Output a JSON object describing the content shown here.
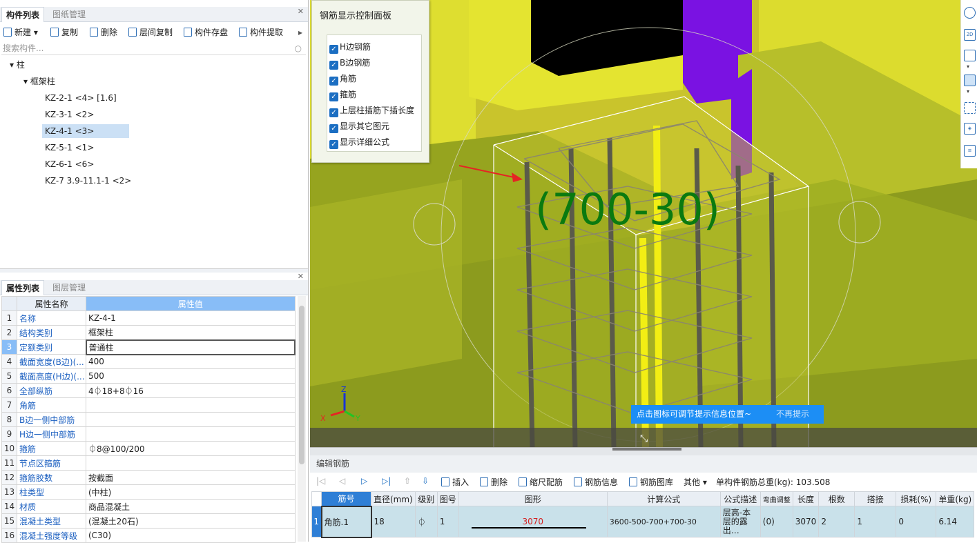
{
  "left_top": {
    "tabs": [
      "构件列表",
      "图纸管理"
    ],
    "toolbar": [
      "新建",
      "复制",
      "删除",
      "层间复制",
      "构件存盘",
      "构件提取"
    ],
    "search_placeholder": "搜索构件...",
    "tree": {
      "root": "柱",
      "group": "框架柱",
      "items": [
        "KZ-2-1 <4> [1.6]",
        "KZ-3-1 <2>",
        "KZ-4-1 <3>",
        "KZ-5-1 <1>",
        "KZ-6-1 <6>",
        "KZ-7 3.9-11.1-1 <2>"
      ],
      "selected_index": 2
    }
  },
  "left_bottom": {
    "tabs": [
      "属性列表",
      "图层管理"
    ],
    "headers": [
      "属性名称",
      "属性值"
    ],
    "rows": [
      {
        "no": "1",
        "name": "名称",
        "value": "KZ-4-1"
      },
      {
        "no": "2",
        "name": "结构类别",
        "value": "框架柱"
      },
      {
        "no": "3",
        "name": "定额类别",
        "value": "普通柱"
      },
      {
        "no": "4",
        "name": "截面宽度(B边)(...",
        "value": "400"
      },
      {
        "no": "5",
        "name": "截面高度(H边)(...",
        "value": "500"
      },
      {
        "no": "6",
        "name": "全部纵筋",
        "value": "4⏀18+8⏀16"
      },
      {
        "no": "7",
        "name": "角筋",
        "value": ""
      },
      {
        "no": "8",
        "name": "B边一侧中部筋",
        "value": ""
      },
      {
        "no": "9",
        "name": "H边一侧中部筋",
        "value": ""
      },
      {
        "no": "10",
        "name": "箍筋",
        "value": "⏀8@100/200"
      },
      {
        "no": "11",
        "name": "节点区箍筋",
        "value": ""
      },
      {
        "no": "12",
        "name": "箍筋胶数",
        "value": "按截面"
      },
      {
        "no": "13",
        "name": "柱类型",
        "value": "(中柱)"
      },
      {
        "no": "14",
        "name": "材质",
        "value": "商品混凝土"
      },
      {
        "no": "15",
        "name": "混凝土类型",
        "value": "(混凝土20石)"
      },
      {
        "no": "16",
        "name": "混凝土强度等级",
        "value": "(C30)"
      }
    ]
  },
  "control_panel": {
    "title": "钢筋显示控制面板",
    "options": [
      "H边钢筋",
      "B边钢筋",
      "角筋",
      "箍筋",
      "上层柱插筋下插长度",
      "显示其它图元",
      "显示详细公式"
    ]
  },
  "viewport": {
    "annotation": "(700-30)",
    "axes": {
      "x": "X",
      "y": "Y",
      "z": "Z"
    },
    "tip_text": "点击图标可调节提示信息位置~",
    "tip_dismiss": "不再提示",
    "colors": {
      "wall": "#e6e62e",
      "slab": "#9aae22",
      "purple": "#7b14e0",
      "annotation": "#0a7a10"
    }
  },
  "rebar_editor": {
    "title": "编辑钢筋",
    "toolbar": [
      "插入",
      "删除",
      "缩尺配筋",
      "钢筋信息",
      "钢筋图库",
      "其他"
    ],
    "total_label": "单构件钢筋总重(kg): 103.508",
    "headers": [
      "筋号",
      "直径(mm)",
      "级别",
      "图号",
      "图形",
      "计算公式",
      "公式描述",
      "弯曲调整",
      "长度",
      "根数",
      "搭接",
      "损耗(%)",
      "单重(kg)"
    ],
    "row": {
      "idx": "1",
      "name": "角筋.1",
      "diameter": "18",
      "grade": "⏀",
      "fig_no": "1",
      "shape_value": "3070",
      "formula": "3600-500-700+700-30",
      "desc": "层高-本层的露出…",
      "bend": "(0)",
      "length": "3070",
      "count": "2",
      "lap": "1",
      "loss": "0",
      "unit_weight": "6.14"
    }
  }
}
